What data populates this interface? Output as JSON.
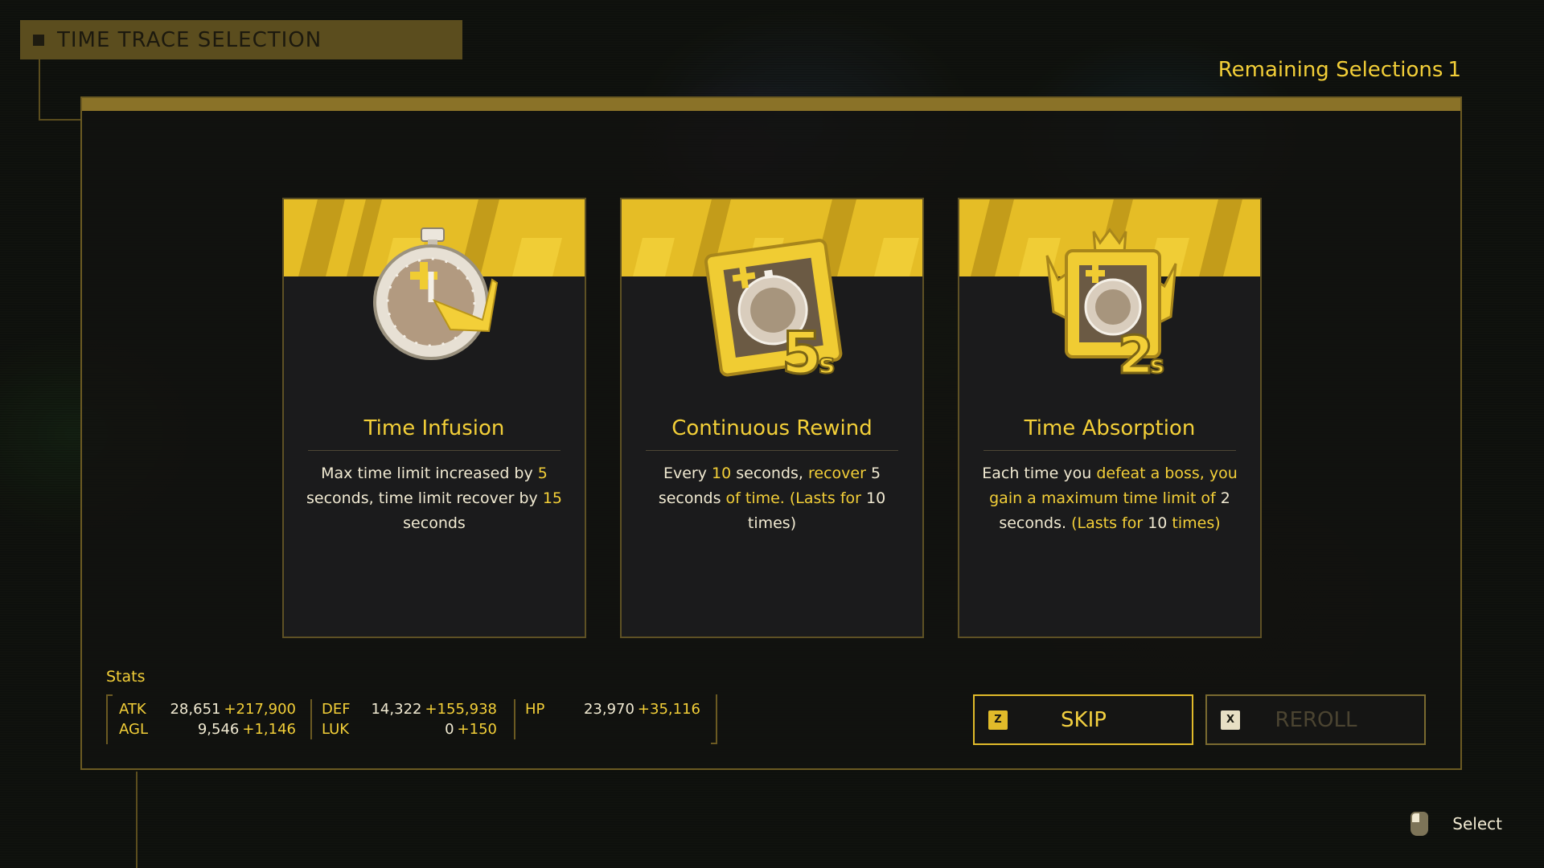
{
  "header": {
    "title": "TIME TRACE SELECTION"
  },
  "remaining": {
    "label": "Remaining Selections",
    "count": "1"
  },
  "cards": [
    {
      "title": "Time Infusion",
      "desc": [
        {
          "t": "Max time limit increased by ",
          "h": false
        },
        {
          "t": "5",
          "h": true
        },
        {
          "t": " seconds, time limit recover by ",
          "h": false
        },
        {
          "t": "15",
          "h": true
        },
        {
          "t": " seconds",
          "h": false
        }
      ]
    },
    {
      "title": "Continuous Rewind",
      "desc": [
        {
          "t": "Every ",
          "h": false
        },
        {
          "t": "10",
          "h": true
        },
        {
          "t": " seconds, ",
          "h": false
        },
        {
          "t": "recover ",
          "h": true
        },
        {
          "t": "5",
          "h": false
        },
        {
          "t": " seconds ",
          "h": false
        },
        {
          "t": "of time. (Lasts for ",
          "h": true
        },
        {
          "t": "10",
          "h": false
        },
        {
          "t": " times)",
          "h": false
        }
      ]
    },
    {
      "title": "Time Absorption",
      "desc": [
        {
          "t": "Each time you ",
          "h": false
        },
        {
          "t": "defeat a boss, you gain a maximum time limit of ",
          "h": true
        },
        {
          "t": "2",
          "h": false
        },
        {
          "t": " seconds. ",
          "h": false
        },
        {
          "t": "(Lasts for ",
          "h": true
        },
        {
          "t": "10",
          "h": false
        },
        {
          "t": " times)",
          "h": true
        }
      ]
    }
  ],
  "stats": {
    "label": "Stats",
    "items": [
      {
        "label": "ATK",
        "base": "28,651",
        "bonus": "+217,900"
      },
      {
        "label": "AGL",
        "base": "9,546",
        "bonus": "+1,146"
      },
      {
        "label": "DEF",
        "base": "14,322",
        "bonus": "+155,938"
      },
      {
        "label": "LUK",
        "base": "0",
        "bonus": "+150"
      },
      {
        "label": "HP",
        "base": "23,970",
        "bonus": "+35,116"
      }
    ]
  },
  "buttons": {
    "skip": {
      "key": "Z",
      "label": "SKIP"
    },
    "reroll": {
      "key": "X",
      "label": "REROLL"
    }
  },
  "hint": {
    "label": "Select",
    "icon": "mouse-icon"
  },
  "colors": {
    "accent": "#f3cf38",
    "panel_border": "#6b5a22",
    "card_banner": "#e5bd26"
  }
}
